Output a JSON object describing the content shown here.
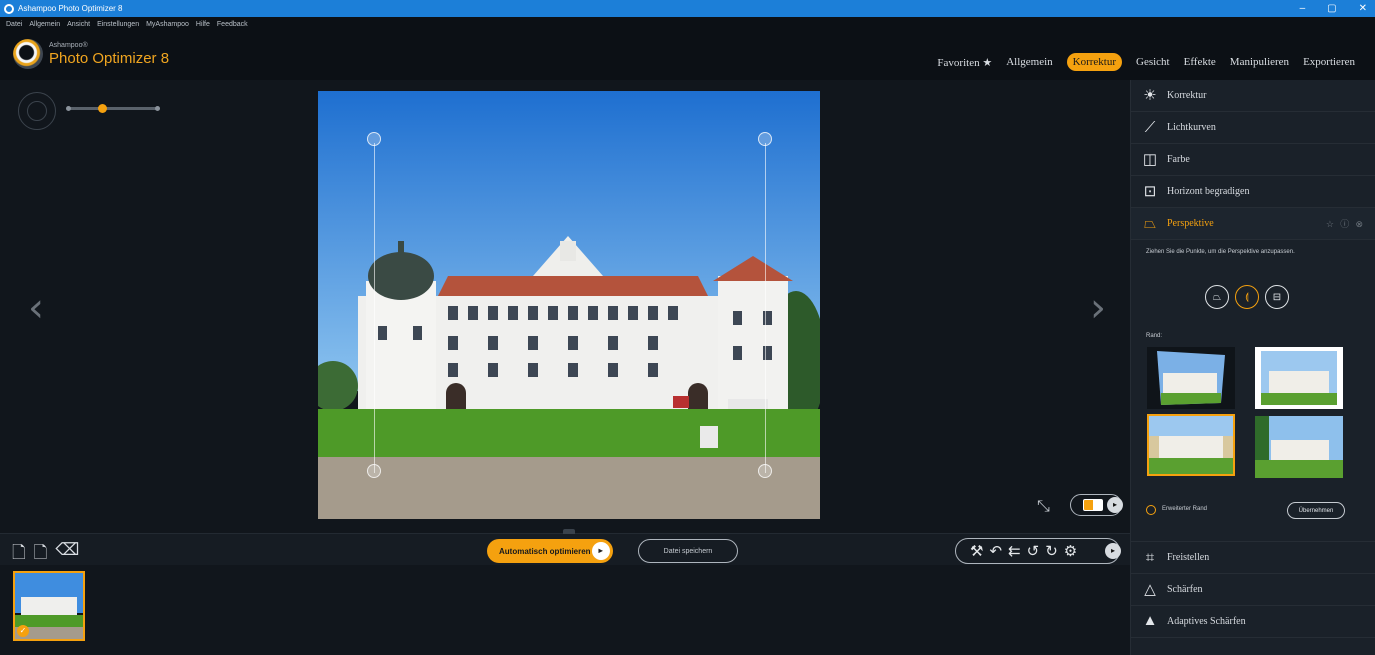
{
  "window": {
    "title": "Ashampoo Photo Optimizer 8",
    "controls": [
      "–",
      "▢",
      "✕"
    ]
  },
  "menu": [
    "Datei",
    "Allgemein",
    "Ansicht",
    "Einstellungen",
    "MyAshampoo",
    "Hilfe",
    "Feedback"
  ],
  "logo": {
    "brand": "Ashampoo®",
    "product": "Photo Optimizer 8"
  },
  "tabs": [
    {
      "label": "Favoriten ★",
      "active": false
    },
    {
      "label": "Allgemein",
      "active": false
    },
    {
      "label": "Korrektur",
      "active": true
    },
    {
      "label": "Gesicht",
      "active": false
    },
    {
      "label": "Effekte",
      "active": false
    },
    {
      "label": "Manipulieren",
      "active": false
    },
    {
      "label": "Exportieren",
      "active": false
    }
  ],
  "zoom": {
    "level_fraction": 0.38
  },
  "toolbar": {
    "auto_optimize": "Automatisch optimieren",
    "save_file": "Datei speichern"
  },
  "panel": {
    "items_top": [
      {
        "label": "Korrektur",
        "icon": "sun-icon",
        "glyph": "☀"
      },
      {
        "label": "Lichtkurven",
        "icon": "curve-icon",
        "glyph": "⟋"
      },
      {
        "label": "Farbe",
        "icon": "color-icon",
        "glyph": "◫"
      },
      {
        "label": "Horizont begradigen",
        "icon": "horizon-icon",
        "glyph": "⊡"
      }
    ],
    "active_item": {
      "label": "Perspektive",
      "icon": "perspective-icon",
      "glyph": "⏢",
      "extras": "☆ ⓘ ⊗"
    },
    "description": "Ziehen Sie die Punkte, um die Perspektive anzupassen.",
    "rand_label": "Rand:",
    "extended_border": "Erweiterter Rand",
    "apply": "Übernehmen",
    "items_bottom": [
      {
        "label": "Freistellen",
        "icon": "crop-icon",
        "glyph": "⌗"
      },
      {
        "label": "Schärfen",
        "icon": "sharpen-icon",
        "glyph": "△"
      },
      {
        "label": "Adaptives Schärfen",
        "icon": "adaptive-sharpen-icon",
        "glyph": "▲"
      }
    ]
  },
  "colors": {
    "accent": "#f5a10f",
    "titlebar": "#1c7fd8",
    "background": "#11161c",
    "panel": "#1a2129"
  }
}
